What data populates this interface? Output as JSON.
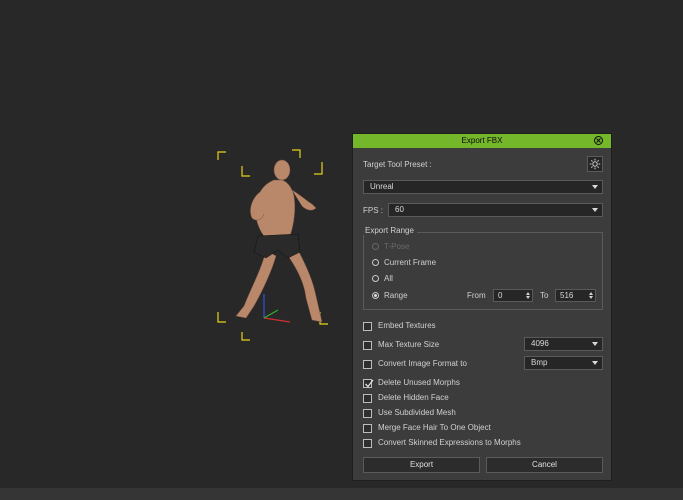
{
  "dialog": {
    "title": "Export FBX",
    "target_preset_label": "Target Tool Preset :",
    "preset_value": "Unreal",
    "fps_label": "FPS :",
    "fps_value": "60",
    "export_range": {
      "title": "Export Range",
      "options": [
        {
          "label": "T-Pose",
          "selected": false,
          "enabled": false
        },
        {
          "label": "Current Frame",
          "selected": false,
          "enabled": true
        },
        {
          "label": "All",
          "selected": false,
          "enabled": true
        },
        {
          "label": "Range",
          "selected": true,
          "enabled": true
        }
      ],
      "from_label": "From",
      "from_value": "0",
      "to_label": "To",
      "to_value": "516"
    },
    "options": {
      "embed_textures": {
        "label": "Embed Textures",
        "checked": false
      },
      "max_texture_size": {
        "label": "Max Texture Size",
        "checked": false,
        "value": "4096"
      },
      "convert_image_format": {
        "label": "Convert Image Format to",
        "checked": false,
        "value": "Bmp"
      },
      "delete_unused_morphs": {
        "label": "Delete Unused Morphs",
        "checked": true
      },
      "delete_hidden_face": {
        "label": "Delete Hidden Face",
        "checked": false
      },
      "use_subdivided_mesh": {
        "label": "Use Subdivided Mesh",
        "checked": false
      },
      "merge_face_hair": {
        "label": "Merge Face Hair To One Object",
        "checked": false
      },
      "convert_skinned_expressions": {
        "label": "Convert Skinned Expressions to Morphs",
        "checked": false
      }
    },
    "export_button": "Export",
    "cancel_button": "Cancel"
  },
  "colors": {
    "title_bar": "#74b72a",
    "dialog_bg": "#3c3c3c",
    "viewport_bg": "#282828",
    "selection_bracket": "#e6d21a"
  },
  "icons": {
    "close": "close-circle-icon",
    "preset": "gear-icon",
    "dropdown": "chevron-down-icon"
  }
}
